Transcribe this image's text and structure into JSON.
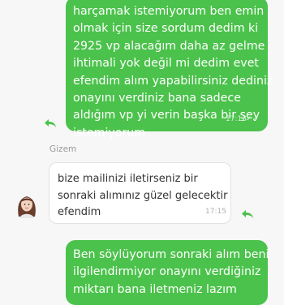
{
  "messages": {
    "outgoing_1": {
      "lines": [
        "harçamak istemiyorum ben emin",
        "olmak için size sordum dedim ki",
        "2925 vp alacağım daha az gelme",
        "ihtimali yok değil mi dedim evet",
        "efendim alım yapabilirsiniz dediniz",
        "onayını verdiniz bana sadece",
        "aldığım vp yi verin başka bir şey",
        "istemiyorum"
      ],
      "time": "17:13",
      "status_icon": "double-check"
    },
    "incoming_1": {
      "sender": "Gizem",
      "lines": [
        "bize mailinizi iletirseniz bir",
        "sonraki alımınız güzel gelecektir",
        "efendim"
      ],
      "time": "17:15"
    },
    "outgoing_2": {
      "lines": [
        "Ben söylüyorum sonraki alım beni",
        "ilgilendirmiyor onayını verdiğiniz",
        "miktarı bana iletmeniz lazım"
      ]
    }
  },
  "icons": {
    "reply": "reply-arrow-icon",
    "avatar": "agent-avatar"
  },
  "colors": {
    "outgoing_bubble": "#4bc24b",
    "incoming_bubble": "#ffffff",
    "background": "#f7f7f7"
  }
}
